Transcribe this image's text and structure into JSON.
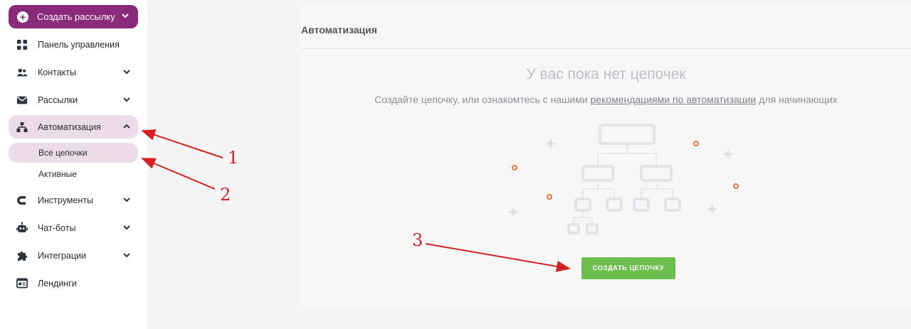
{
  "sidebar": {
    "create_label": "Создать рассылку",
    "items": [
      {
        "label": "Панель управления",
        "icon": "dashboard-icon"
      },
      {
        "label": "Контакты",
        "icon": "contacts-icon"
      },
      {
        "label": "Рассылки",
        "icon": "mail-icon"
      },
      {
        "label": "Автоматизация",
        "icon": "automation-icon"
      },
      {
        "label": "Инструменты",
        "icon": "magnet-icon"
      },
      {
        "label": "Чат-боты",
        "icon": "bot-icon"
      },
      {
        "label": "Интеграции",
        "icon": "puzzle-icon"
      },
      {
        "label": "Лендинги",
        "icon": "landing-icon"
      }
    ],
    "sub_items": [
      {
        "label": "Все цепочки"
      },
      {
        "label": "Активные"
      }
    ]
  },
  "main": {
    "title": "Автоматизация",
    "empty_title": "У вас пока нет цепочек",
    "empty_text_before": "Создайте цепочку, или ознакомтесь с нашими",
    "empty_link": "рекомендациями по автоматизации",
    "empty_text_after": "для начинающих",
    "create_button": "СОЗДАТЬ ЦЕПОЧКУ"
  },
  "annotations": [
    "1",
    "2",
    "3"
  ],
  "colors": {
    "brand": "#8a2a7a",
    "active_bg": "#ecdcea",
    "button_green": "#6cbf4e",
    "annotation_red": "#d42020",
    "accent_orange": "#e8743b"
  }
}
